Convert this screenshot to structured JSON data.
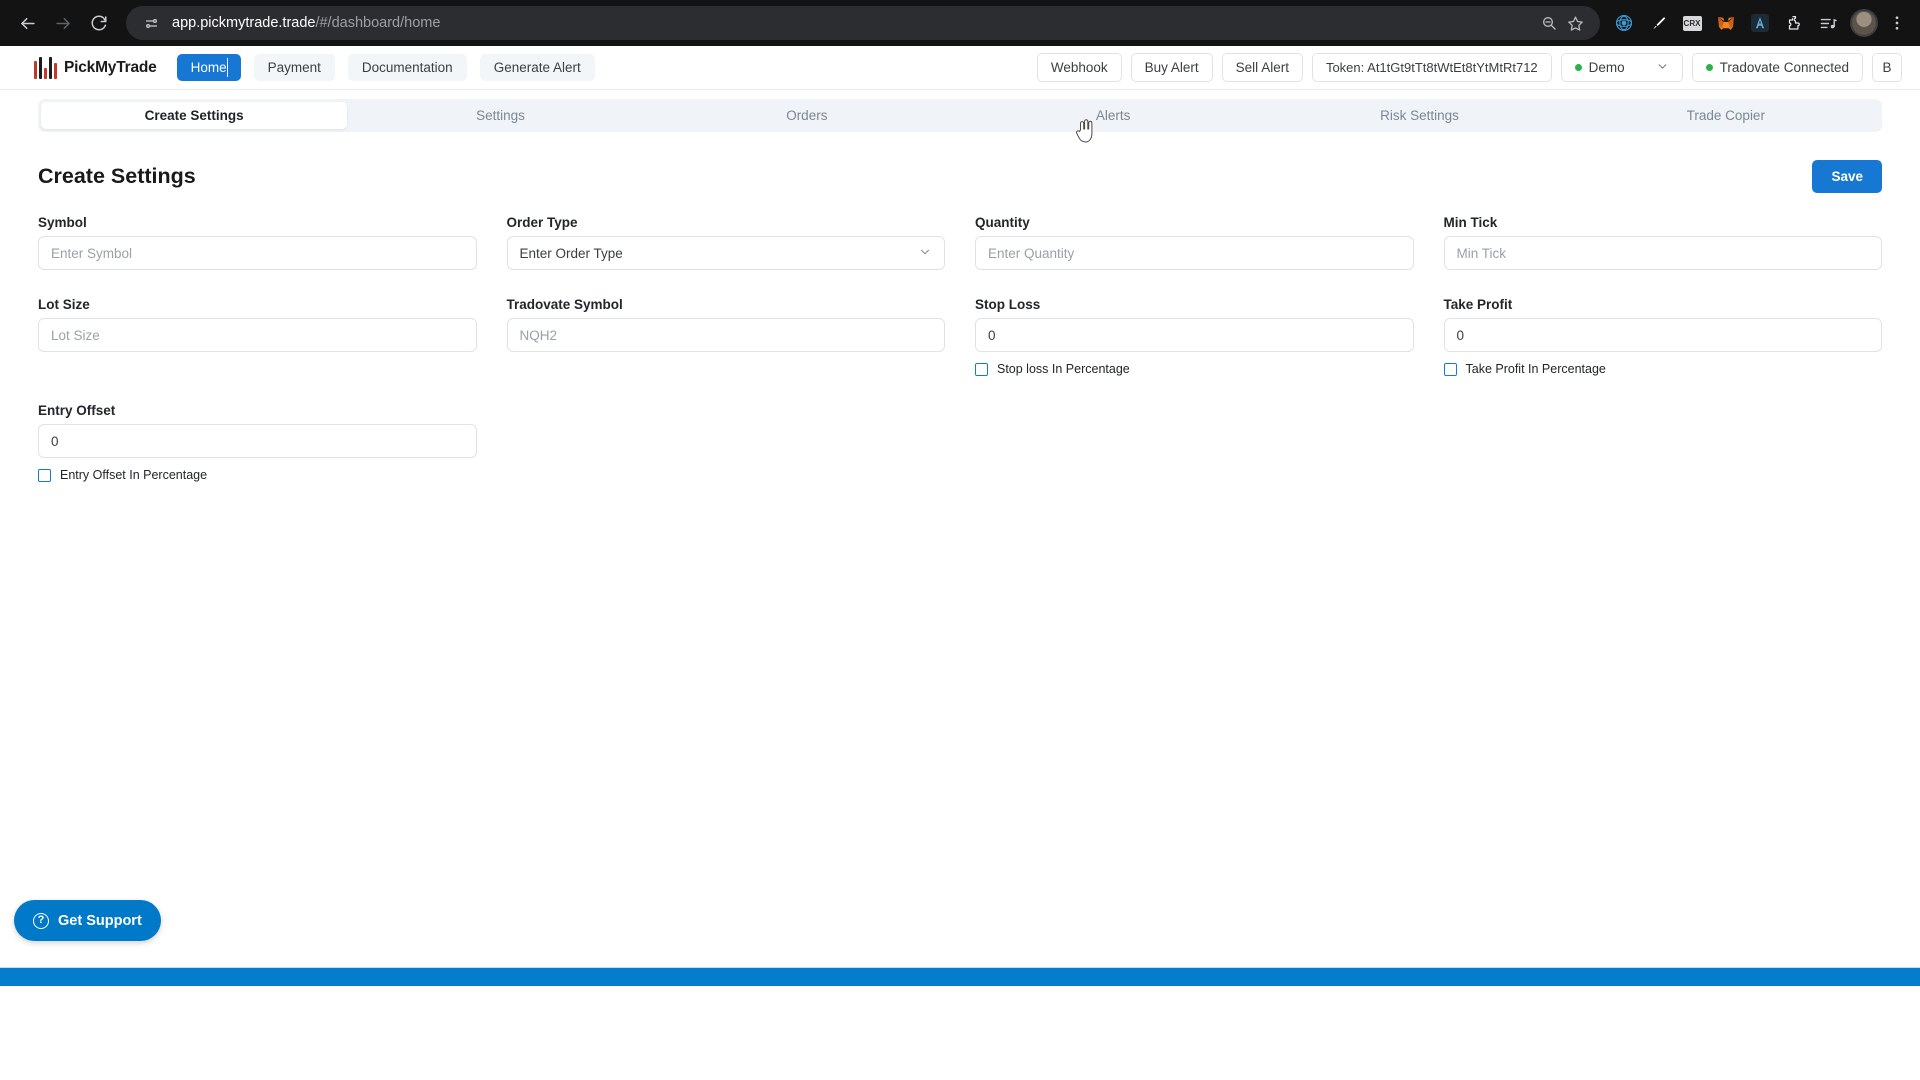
{
  "browser": {
    "back_icon": "arrow-left-icon",
    "forward_icon": "arrow-right-icon",
    "reload_icon": "reload-icon",
    "site_info_icon": "tune-icon",
    "url_host": "app.pickmytrade.trade",
    "url_path": "/#/dashboard/home",
    "zoom_out_icon": "zoom-out-icon",
    "bookmark_icon": "star-icon",
    "extensions": [
      {
        "name": "web3-extension-icon"
      },
      {
        "name": "brush-extension-icon"
      },
      {
        "name": "crx-extension-icon"
      },
      {
        "name": "metamask-extension-icon"
      },
      {
        "name": "atlas-extension-icon"
      },
      {
        "name": "puzzle-extensions-icon"
      }
    ],
    "media_icon": "media-list-icon",
    "profile_icon": "profile-avatar",
    "menu_icon": "kebab-menu-icon"
  },
  "header": {
    "brand": "PickMyTrade",
    "nav": [
      {
        "label": "Home",
        "active": true
      },
      {
        "label": "Payment",
        "active": false
      },
      {
        "label": "Documentation",
        "active": false
      },
      {
        "label": "Generate Alert",
        "active": false
      }
    ],
    "actions": [
      {
        "label": "Webhook"
      },
      {
        "label": "Buy Alert"
      },
      {
        "label": "Sell Alert"
      }
    ],
    "token_label": "Token: At1tGt9tTt8tWtEt8tYtMtRt712",
    "account_mode": "Demo",
    "connection_status": "Tradovate Connected",
    "user_initial": "B",
    "status_dot_color": "#2bb24c",
    "accent_color": "#1778d4"
  },
  "tabs": [
    {
      "label": "Create Settings",
      "active": true
    },
    {
      "label": "Settings",
      "active": false
    },
    {
      "label": "Orders",
      "active": false
    },
    {
      "label": "Alerts",
      "active": false
    },
    {
      "label": "Risk Settings",
      "active": false
    },
    {
      "label": "Trade Copier",
      "active": false
    }
  ],
  "page": {
    "title": "Create Settings",
    "save_label": "Save"
  },
  "form": {
    "symbol": {
      "label": "Symbol",
      "placeholder": "Enter Symbol",
      "value": ""
    },
    "order_type": {
      "label": "Order Type",
      "placeholder": "Enter Order Type",
      "value": ""
    },
    "quantity": {
      "label": "Quantity",
      "placeholder": "Enter Quantity",
      "value": ""
    },
    "min_tick": {
      "label": "Min Tick",
      "placeholder": "Min Tick",
      "value": ""
    },
    "lot_size": {
      "label": "Lot Size",
      "placeholder": "Lot Size",
      "value": ""
    },
    "tradovate_symbol": {
      "label": "Tradovate Symbol",
      "placeholder": "NQH2",
      "value": ""
    },
    "stop_loss": {
      "label": "Stop Loss",
      "value": "0",
      "checkbox_label": "Stop loss In Percentage",
      "checked": false
    },
    "take_profit": {
      "label": "Take Profit",
      "value": "0",
      "checkbox_label": "Take Profit In Percentage",
      "checked": false
    },
    "entry_offset": {
      "label": "Entry Offset",
      "value": "0",
      "checkbox_label": "Entry Offset In Percentage",
      "checked": false
    }
  },
  "support": {
    "label": "Get Support",
    "icon": "question-circle-icon"
  }
}
